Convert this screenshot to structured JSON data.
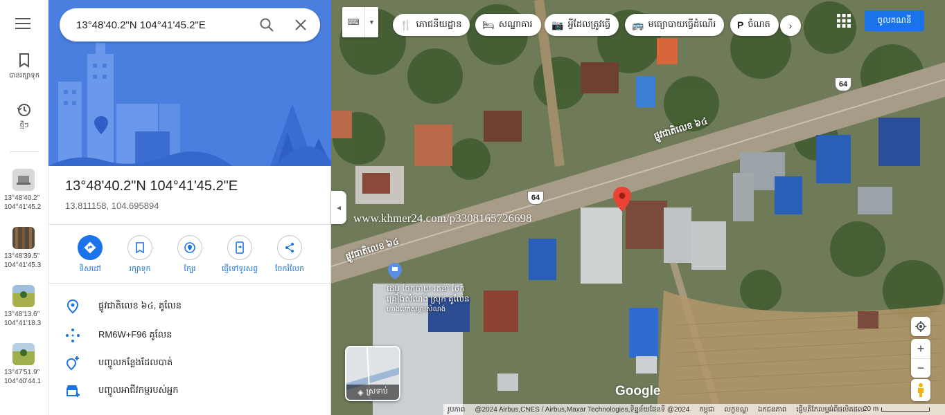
{
  "rail": {
    "saved_label": "បានរក្សាទុក",
    "recents_label": "ថ្មីៗ",
    "recent_items": [
      {
        "lat": "13°48'40.2\"",
        "lng": "104°41'45.2"
      },
      {
        "lat": "13°48'39.5\"",
        "lng": "104°41'45.3"
      },
      {
        "lat": "13°48'13.6\"",
        "lng": "104°41'18.3"
      },
      {
        "lat": "13°47'51.9\"",
        "lng": "104°40'44.1"
      }
    ]
  },
  "search": {
    "value": "13°48'40.2\"N 104°41'45.2\"E"
  },
  "place": {
    "title": "13°48'40.2\"N 104°41'45.2\"E",
    "decimal": "13.811158, 104.695894"
  },
  "actions": {
    "directions": "ទិសដៅ",
    "save": "រក្សាទុក",
    "nearby": "ក្បែរ",
    "send_to_phone": "ផ្ញើទៅទូរសព្ទ",
    "share": "ចែករំលែក"
  },
  "details": {
    "address": "ផ្លូវជាតិលេខ ៦៤, គូលែន",
    "plus_code": "RM6W+F96 គូលែន",
    "add_missing_place": "បញ្ចូលកន្លែងដែលបាត់",
    "add_business": "បញ្ចូលអាជីវកម្មរបស់អ្នក"
  },
  "map": {
    "chips": [
      {
        "icon": "fork-knife-icon",
        "label": "ភោជនីយដ្ឋាន"
      },
      {
        "icon": "bed-icon",
        "label": "សណ្ឋាគារ"
      },
      {
        "icon": "camera-icon",
        "label": "អ្វីដែលត្រូវធ្វើ"
      },
      {
        "icon": "bus-icon",
        "label": "មធ្យោបាយធ្វើដំណើរ"
      },
      {
        "icon": "parking-icon",
        "label": "ចំណត"
      }
    ],
    "signin_label": "ចូលគណនី",
    "layers_label": "ស្រទាប់",
    "road_label": "ផ្លូវជាតិលេខ ៦៤",
    "shield_label": "64",
    "poi_label_1": "ដេប៉ូ ចែកចាយ រតនា ថែក",
    "poi_label_2": "គ្រឿងសំណង់ ស្រុក គូលែន",
    "poi_label_3": "ហាងលក់សម្ភារសំណង់",
    "watermark": "www.khmer24.com/p3308165726698",
    "google_logo": "Google",
    "attribution": "@2024 Airbus,CNES / Airbus,Maxar Technologies,ទិន្នន័យផែនទី @2024",
    "attrib_prefix": "រូបភាព",
    "attrib_links": [
      "កម្ពុជា",
      "លក្ខខណ្ឌ",
      "ឯកជនភាព",
      "ផ្ញើមតិកែលម្អអំពីផលិតផល"
    ],
    "scale_label": "20 m"
  },
  "colors": {
    "accent": "#1a73e8",
    "pin": "#ea4335",
    "hero_bg": "#4a7fe0"
  }
}
